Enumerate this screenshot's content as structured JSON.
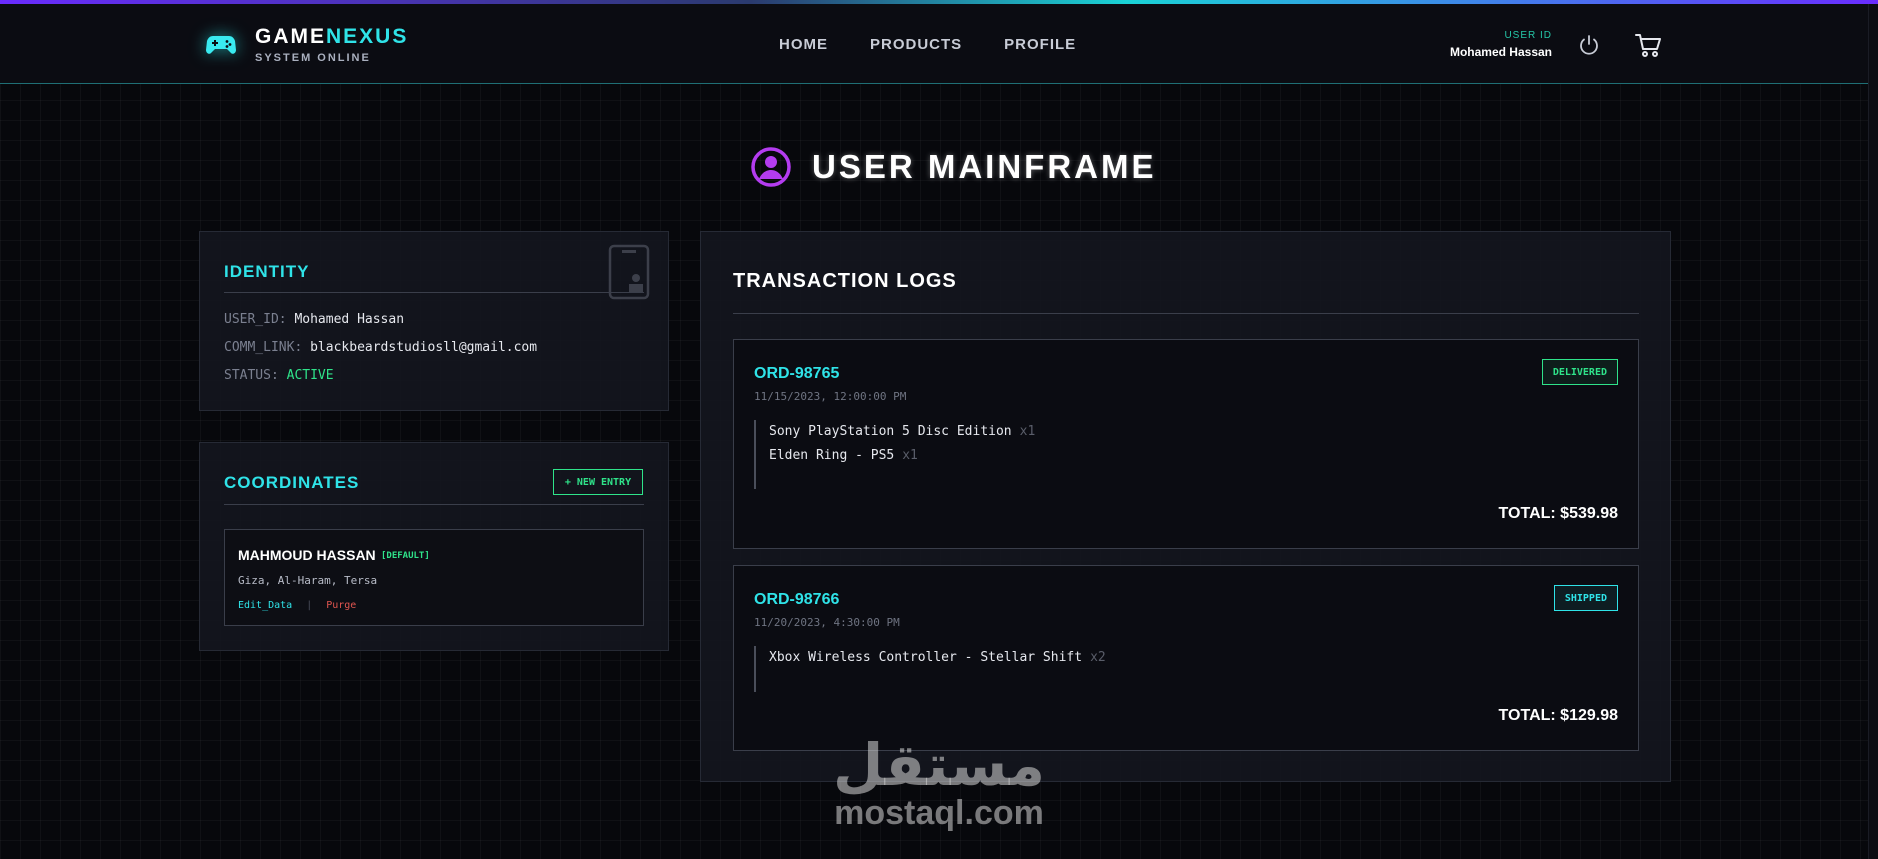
{
  "header": {
    "brand_primary": "GAME",
    "brand_accent": "NEXUS",
    "brand_status": "SYSTEM ONLINE",
    "nav": [
      "HOME",
      "PRODUCTS",
      "PROFILE"
    ],
    "user_label": "USER ID",
    "user_name": "Mohamed Hassan",
    "icons": [
      "gamepad-icon",
      "power-icon",
      "cart-icon"
    ]
  },
  "page": {
    "title": "USER MAINFRAME",
    "title_icon": "user-circle-icon"
  },
  "identity": {
    "title": "IDENTITY",
    "fields": [
      {
        "key": "USER_ID:",
        "value": "Mohamed Hassan"
      },
      {
        "key": "COMM_LINK:",
        "value": "blackbeardstudiosll@gmail.com"
      },
      {
        "key": "STATUS:",
        "value": "ACTIVE"
      }
    ]
  },
  "coordinates": {
    "title": "COORDINATES",
    "new_entry_label": "+ NEW ENTRY",
    "addresses": [
      {
        "name": "MAHMOUD HASSAN",
        "tag": "[DEFAULT]",
        "line": "Giza, Al-Haram, Tersa",
        "edit_label": "Edit_Data",
        "separator": "|",
        "purge_label": "Purge"
      }
    ]
  },
  "transactions": {
    "title": "TRANSACTION LOGS",
    "orders": [
      {
        "id": "ORD-98765",
        "date": "11/15/2023, 12:00:00 PM",
        "status": "DELIVERED",
        "items": [
          {
            "name": "Sony PlayStation 5 Disc Edition",
            "qty": "x1"
          },
          {
            "name": "Elden Ring - PS5",
            "qty": "x1"
          }
        ],
        "total": "TOTAL: $539.98"
      },
      {
        "id": "ORD-98766",
        "date": "11/20/2023, 4:30:00 PM",
        "status": "SHIPPED",
        "items": [
          {
            "name": "Xbox Wireless Controller - Stellar Shift",
            "qty": "x2"
          }
        ],
        "total": "TOTAL: $129.98"
      }
    ]
  },
  "watermark": {
    "arabic": "مستقل",
    "latin": "mostaql.com"
  },
  "colors": {
    "accent_cyan": "#2fe3e8",
    "accent_green": "#2fe38a",
    "accent_purple": "#b43cf0",
    "danger": "#e0554f",
    "background": "#07080c"
  }
}
